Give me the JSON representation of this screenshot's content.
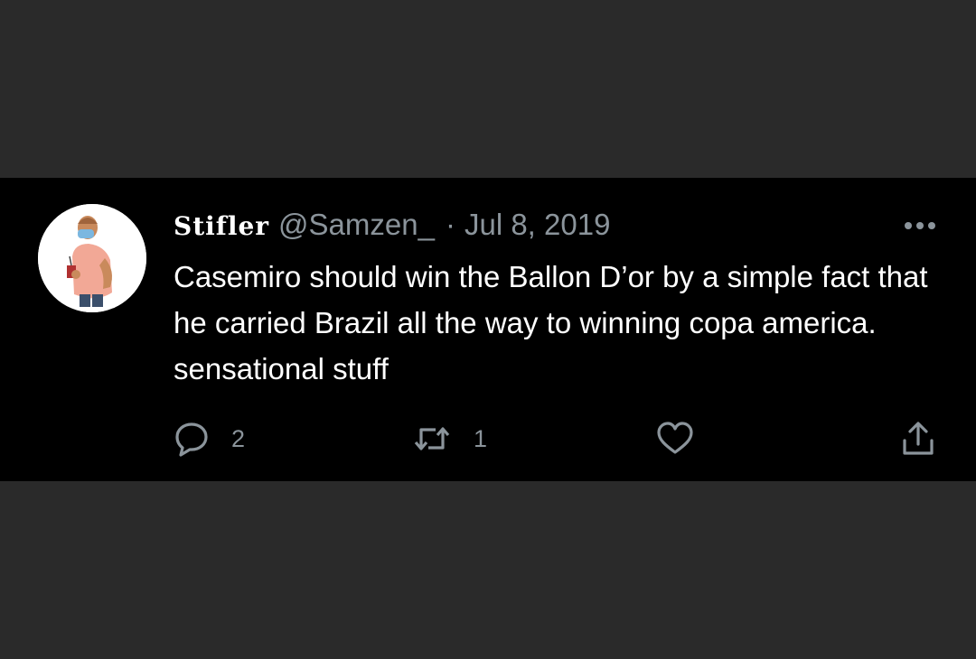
{
  "tweet": {
    "display_name": "Stifler",
    "handle": "@Samzen_",
    "separator": "·",
    "date": "Jul 8, 2019",
    "text": "Casemiro should win the Ballon D’or by a simple fact that he carried Brazil all the way to winning copa america. sensational stuff",
    "reply_count": "2",
    "retweet_count": "1",
    "icons": {
      "more": "more-horizontal-icon",
      "reply": "reply-bubble-icon",
      "retweet": "retweet-icon",
      "like": "heart-icon",
      "share": "share-icon"
    }
  },
  "colors": {
    "background": "#2a2a2a",
    "tweet_background": "#000000",
    "text": "#ffffff",
    "muted": "#8b949b"
  }
}
